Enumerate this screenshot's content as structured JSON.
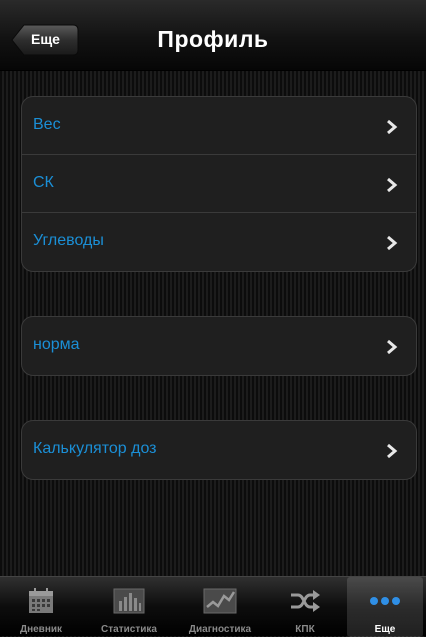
{
  "navbar": {
    "back_label": "Еще",
    "title": "Профиль"
  },
  "groups": [
    {
      "items": [
        {
          "label": "Вес"
        },
        {
          "label": "СК"
        },
        {
          "label": "Углеводы"
        }
      ]
    },
    {
      "items": [
        {
          "label": "норма"
        }
      ]
    },
    {
      "items": [
        {
          "label": "Калькулятор доз"
        }
      ]
    }
  ],
  "tabbar": {
    "tabs": [
      {
        "label": "Дневник",
        "icon": "calendar-icon"
      },
      {
        "label": "Статистика",
        "icon": "bar-chart-icon"
      },
      {
        "label": "Диагностика",
        "icon": "line-chart-icon"
      },
      {
        "label": "КПК",
        "icon": "shuffle-icon"
      },
      {
        "label": "Еще",
        "icon": "more-dots-icon"
      }
    ],
    "active_index": 4
  },
  "colors": {
    "accent_label": "#1b8fd6",
    "active_dots": "#2f8fe6"
  }
}
